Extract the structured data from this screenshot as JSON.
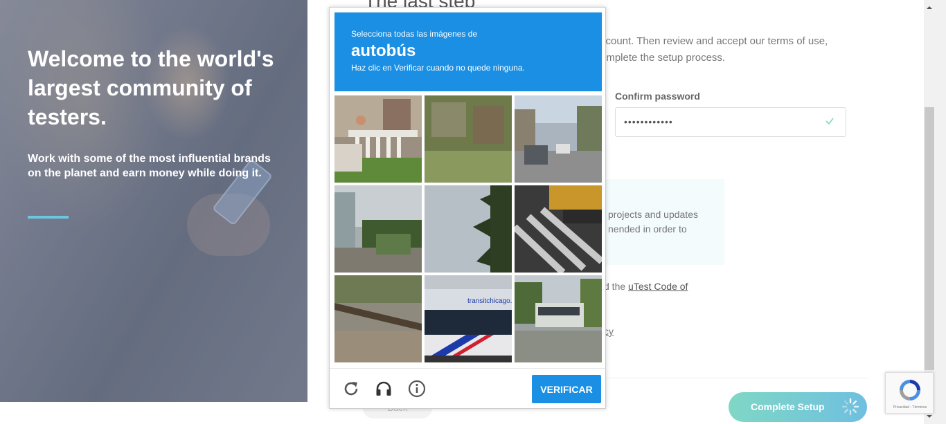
{
  "hero": {
    "title": "Welcome to the world's largest community of testers.",
    "subtitle": "Work with some of the most influential brands on the planet and earn money while doing it."
  },
  "form": {
    "heading": "The last step",
    "description": "ccount. Then review and accept our terms of use, omplete the setup process.",
    "confirm_password_label": "Confirm password",
    "confirm_password_value": "••••••••••••",
    "info_text": "projects and updates nended in order to",
    "code_prefix": "d the ",
    "code_link": "uTest Code of",
    "policy_fragment": "cy",
    "back_label": "Back",
    "complete_setup_label": "Complete Setup"
  },
  "captcha": {
    "instruction": "Selecciona todas las imágenes de",
    "target": "autobús",
    "subtext": "Haz clic en Verificar cuando no quede ninguna.",
    "verify_label": "VERIFICAR",
    "tiles": [
      {
        "label": "porch with stairs"
      },
      {
        "label": "overgrown fence"
      },
      {
        "label": "street with cars"
      },
      {
        "label": "house with palm trees"
      },
      {
        "label": "palm tree"
      },
      {
        "label": "crosswalk and school bus"
      },
      {
        "label": "railroad tracks"
      },
      {
        "label": "city bus side"
      },
      {
        "label": "bus on street"
      }
    ],
    "bus_sign_text": "transitchicago.com"
  },
  "recaptcha_badge": {
    "text": "Privacidad - Términos"
  },
  "colors": {
    "captcha_blue": "#1a8fe3",
    "hero_accent": "#6ec6de",
    "button_gradient_start": "#7fd7c5",
    "button_gradient_end": "#6fbfe0"
  }
}
